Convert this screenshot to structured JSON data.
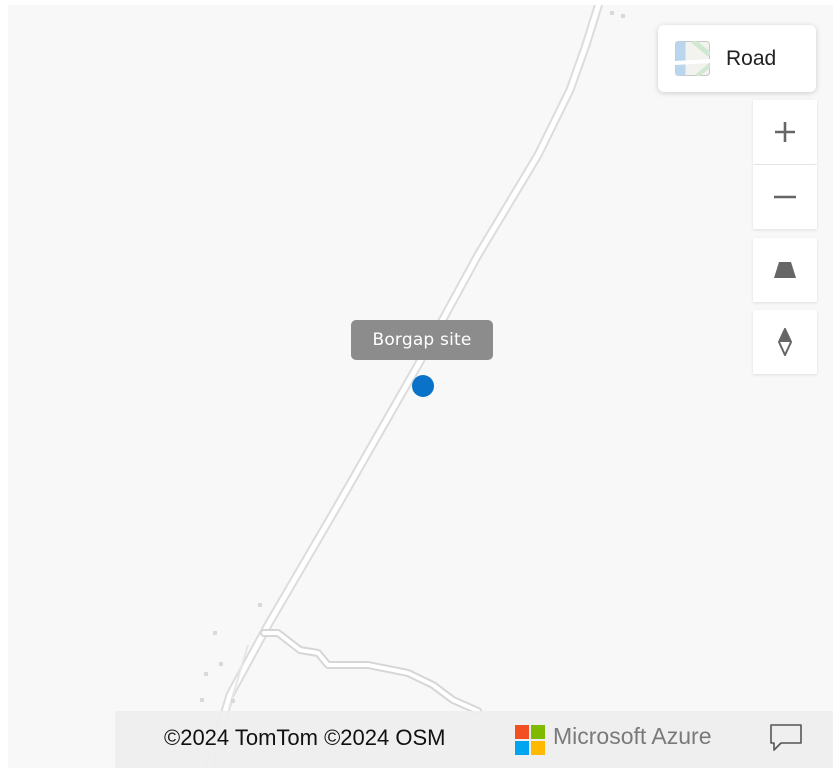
{
  "map": {
    "style_picker": {
      "label": "Road",
      "icon": "road-style-thumbnail-icon"
    },
    "controls": [
      {
        "name": "zoom-in",
        "icon": "plus-icon"
      },
      {
        "name": "zoom-out",
        "icon": "minus-icon"
      },
      {
        "name": "pitch",
        "icon": "pitch-trapezoid-icon"
      },
      {
        "name": "compass",
        "icon": "compass-icon"
      }
    ],
    "popup": {
      "label": "Borgap site"
    },
    "marker": {
      "color": "#0a72c8"
    },
    "attribution": {
      "copyright": "©2024 TomTom ©2024 OSM",
      "brand": "Microsoft Azure",
      "feedback_icon": "feedback-speech-bubble-icon"
    },
    "colors": {
      "background": "#f8f8f8",
      "road_casing": "#dcdcdc",
      "road_fill": "#ffffff",
      "popup_bg": "#8c8c8c",
      "control_icon": "#666666"
    }
  }
}
